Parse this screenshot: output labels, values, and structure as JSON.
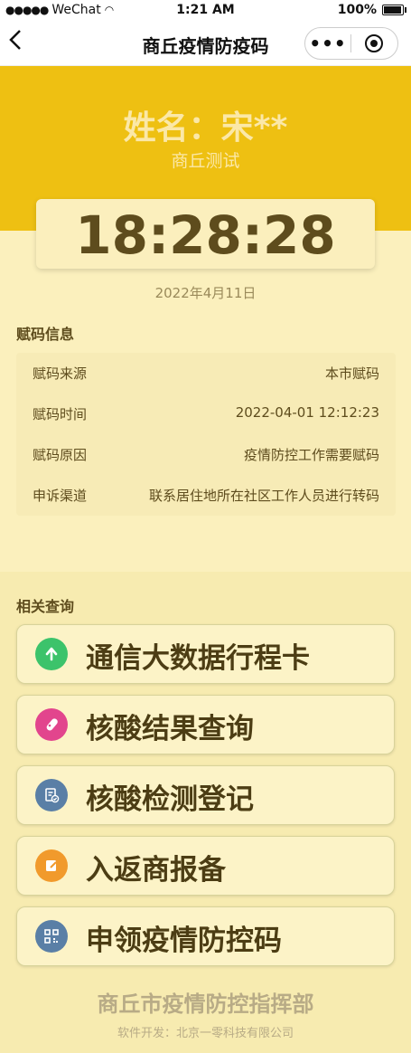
{
  "status_bar": {
    "carrier": "WeChat",
    "time": "1:21 AM",
    "battery": "100%"
  },
  "nav": {
    "title": "商丘疫情防疫码",
    "more": "•••"
  },
  "header": {
    "name": "姓名：宋**",
    "subtitle": "商丘测试"
  },
  "clock": {
    "time": "18:28:28",
    "date": "2022年4月11日"
  },
  "info": {
    "title": "赋码信息",
    "rows": [
      {
        "label": "赋码来源",
        "value": "本市赋码"
      },
      {
        "label": "赋码时间",
        "value": "2022-04-01 12:12:23"
      },
      {
        "label": "赋码原因",
        "value": "疫情防控工作需要赋码"
      },
      {
        "label": "申诉渠道",
        "value": "联系居住地所在社区工作人员进行转码"
      }
    ]
  },
  "related": {
    "title": "相关查询",
    "items": [
      {
        "label": "通信大数据行程卡",
        "icon": "arrow-up-icon",
        "color": "#3cc36b"
      },
      {
        "label": "核酸结果查询",
        "icon": "test-tube-icon",
        "color": "#e2458d"
      },
      {
        "label": "核酸检测登记",
        "icon": "form-check-icon",
        "color": "#5a7fa6"
      },
      {
        "label": "入返商报备",
        "icon": "edit-note-icon",
        "color": "#f19a2c"
      },
      {
        "label": "申领疫情防控码",
        "icon": "qr-code-icon",
        "color": "#5a7fa6"
      }
    ]
  },
  "footer": {
    "org": "商丘市疫情防控指挥部",
    "developer": "软件开发：北京一零科技有限公司"
  }
}
